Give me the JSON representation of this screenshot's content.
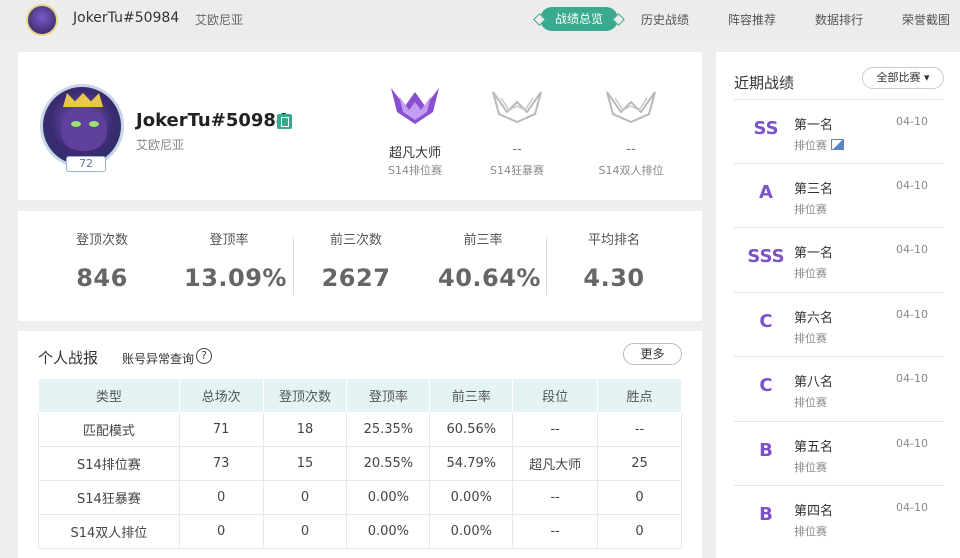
{
  "header": {
    "name": "JokerTu#50984",
    "region": "艾欧尼亚",
    "nav": {
      "active": "战绩总览",
      "history": "历史战绩",
      "lineup": "阵容推荐",
      "ranking": "数据排行",
      "honor": "荣誉截图"
    }
  },
  "profile": {
    "name": "JokerTu#50984",
    "region": "艾欧尼亚",
    "level": "72",
    "ranks": [
      {
        "tier": "超凡大师",
        "mode": "S14排位赛"
      },
      {
        "tier": "--",
        "mode": "S14狂暴赛"
      },
      {
        "tier": "--",
        "mode": "S14双人排位"
      }
    ]
  },
  "stats": [
    {
      "label": "登顶次数",
      "value": "846"
    },
    {
      "label": "登顶率",
      "value": "13.09%"
    },
    {
      "label": "前三次数",
      "value": "2627"
    },
    {
      "label": "前三率",
      "value": "40.64%"
    },
    {
      "label": "平均排名",
      "value": "4.30"
    }
  ],
  "report": {
    "title": "个人战报",
    "query": "账号异常查询",
    "more": "更多",
    "headers": [
      "类型",
      "总场次",
      "登顶次数",
      "登顶率",
      "前三率",
      "段位",
      "胜点"
    ],
    "rows": [
      [
        "匹配模式",
        "71",
        "18",
        "25.35%",
        "60.56%",
        "--",
        "--"
      ],
      [
        "S14排位赛",
        "73",
        "15",
        "20.55%",
        "54.79%",
        "超凡大师",
        "25"
      ],
      [
        "S14狂暴赛",
        "0",
        "0",
        "0.00%",
        "0.00%",
        "--",
        "0"
      ],
      [
        "S14双人排位",
        "0",
        "0",
        "0.00%",
        "0.00%",
        "--",
        "0"
      ]
    ]
  },
  "recent": {
    "title": "近期战绩",
    "filter": "全部比赛",
    "items": [
      {
        "grade": "SS",
        "place": "第一名",
        "mode": "排位赛",
        "date": "04-10"
      },
      {
        "grade": "A",
        "place": "第三名",
        "mode": "排位赛",
        "date": "04-10"
      },
      {
        "grade": "SSS",
        "place": "第一名",
        "mode": "排位赛",
        "date": "04-10"
      },
      {
        "grade": "C",
        "place": "第六名",
        "mode": "排位赛",
        "date": "04-10"
      },
      {
        "grade": "C",
        "place": "第八名",
        "mode": "排位赛",
        "date": "04-10"
      },
      {
        "grade": "B",
        "place": "第五名",
        "mode": "排位赛",
        "date": "04-10"
      },
      {
        "grade": "B",
        "place": "第四名",
        "mode": "排位赛",
        "date": "04-10"
      }
    ]
  },
  "colors": {
    "accent": "#3aaa8e",
    "grade": "#7b52c8",
    "table_header": "#e4f4f4"
  }
}
